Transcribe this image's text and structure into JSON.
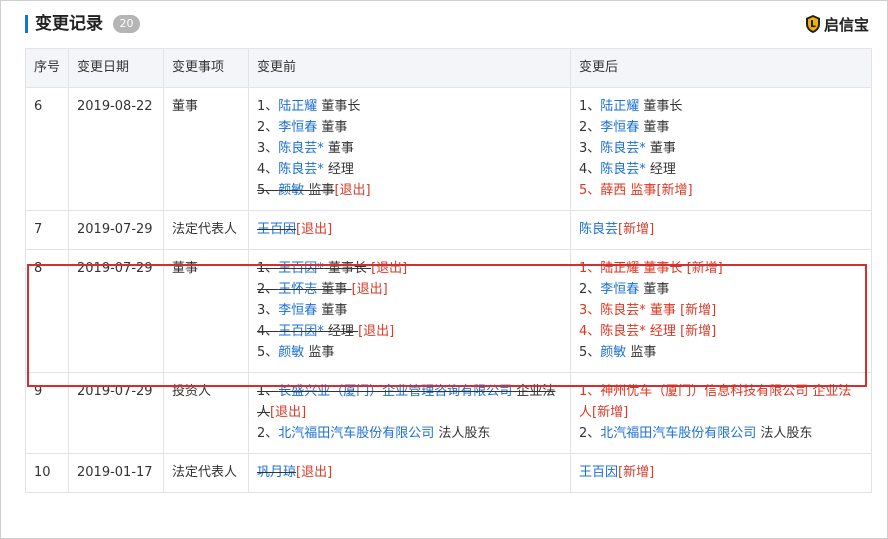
{
  "header": {
    "title": "变更记录",
    "count": "20",
    "brand": "启信宝"
  },
  "table": {
    "columns": [
      "序号",
      "变更日期",
      "变更事项",
      "变更前",
      "变更后"
    ],
    "rows": [
      {
        "no": "6",
        "date": "2019-08-22",
        "item": "董事",
        "before": [
          {
            "idx": "1、",
            "name": "陆正耀",
            "role": " 董事长"
          },
          {
            "idx": "2、",
            "name": "李恒春",
            "role": " 董事"
          },
          {
            "idx": "3、",
            "name": "陈良芸*",
            "role": " 董事"
          },
          {
            "idx": "4、",
            "name": "陈良芸*",
            "role": " 经理"
          },
          {
            "idx": "5、",
            "name": "颜敏",
            "role": " 监事",
            "tag": "[退出]",
            "strike": true
          }
        ],
        "after": [
          {
            "idx": "1、",
            "name": "陆正耀",
            "role": " 董事长"
          },
          {
            "idx": "2、",
            "name": "李恒春",
            "role": " 董事"
          },
          {
            "idx": "3、",
            "name": "陈良芸*",
            "role": " 董事"
          },
          {
            "idx": "4、",
            "name": "陈良芸*",
            "role": " 经理"
          },
          {
            "idx": "5、",
            "name": "薛西",
            "role": " 监事",
            "tag": "[新增]",
            "red": true
          }
        ]
      },
      {
        "no": "7",
        "date": "2019-07-29",
        "item": "法定代表人",
        "before": [
          {
            "idx": "",
            "name": "王百因",
            "role": "",
            "tag": "[退出]",
            "strike": true
          }
        ],
        "after": [
          {
            "idx": "",
            "name": "陈良芸",
            "role": "",
            "tag": "[新增]"
          }
        ]
      },
      {
        "no": "8",
        "date": "2019-07-29",
        "item": "董事",
        "before": [
          {
            "idx": "1、",
            "name": "王百因*",
            "role": " 董事长 ",
            "tag": "[退出]",
            "strike": true
          },
          {
            "idx": "2、",
            "name": "王怀志",
            "role": " 董事 ",
            "tag": "[退出]",
            "strike": true
          },
          {
            "idx": "3、",
            "name": "李恒春",
            "role": " 董事"
          },
          {
            "idx": "4、",
            "name": "王百因*",
            "role": " 经理 ",
            "tag": "[退出]",
            "strike": true
          },
          {
            "idx": "5、",
            "name": "颜敏",
            "role": " 监事"
          }
        ],
        "after": [
          {
            "idx": "1、",
            "name": "陆正耀",
            "role": " 董事长 ",
            "tag": "[新增]",
            "red": true
          },
          {
            "idx": "2、",
            "name": "李恒春",
            "role": " 董事"
          },
          {
            "idx": "3、",
            "name": "陈良芸*",
            "role": " 董事 ",
            "tag": "[新增]",
            "red": true
          },
          {
            "idx": "4、",
            "name": "陈良芸*",
            "role": " 经理 ",
            "tag": "[新增]",
            "red": true
          },
          {
            "idx": "5、",
            "name": "颜敏",
            "role": " 监事"
          }
        ]
      },
      {
        "no": "9",
        "date": "2019-07-29",
        "item": "投资人",
        "before": [
          {
            "idx": "1、",
            "name": "长盛兴业（厦门）企业管理咨询有限公司",
            "role": " 企业法人",
            "tag": "[退出]",
            "strike": true,
            "wrap": true
          },
          {
            "idx": "2、",
            "name": "北汽福田汽车股份有限公司",
            "role": " 法人股东"
          }
        ],
        "after": [
          {
            "idx": "1、",
            "name": "神州优车（厦门）信息科技有限公司",
            "role": " 企业法人",
            "tag": "[新增]",
            "red": true,
            "wrap": true
          },
          {
            "idx": "2、",
            "name": "北汽福田汽车股份有限公司",
            "role": " 法人股东"
          }
        ]
      },
      {
        "no": "10",
        "date": "2019-01-17",
        "item": "法定代表人",
        "before": [
          {
            "idx": "",
            "name": "巩月琼",
            "role": "",
            "tag": "[退出]",
            "strike": true
          }
        ],
        "after": [
          {
            "idx": "",
            "name": "王百因",
            "role": "",
            "tag": "[新增]"
          }
        ]
      }
    ]
  }
}
